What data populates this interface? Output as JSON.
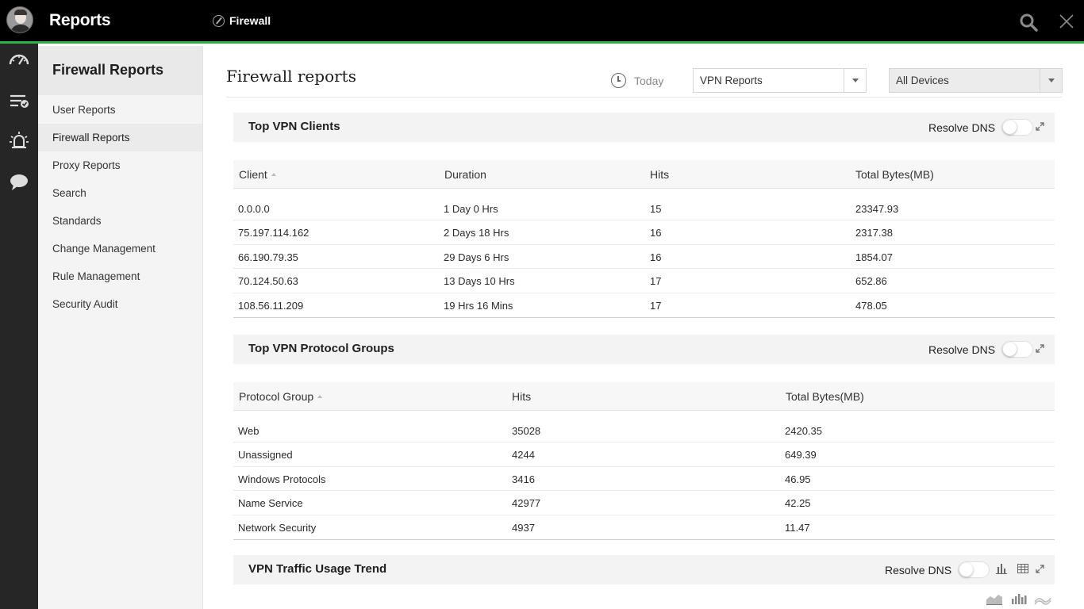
{
  "header": {
    "app_title": "Reports",
    "module": "Firewall"
  },
  "rail": {
    "items": [
      "dashboard-icon",
      "reports-icon",
      "alarms-icon",
      "chat-icon"
    ]
  },
  "sidebar": {
    "title": "Firewall Reports",
    "items": [
      {
        "label": "User Reports"
      },
      {
        "label": "Firewall Reports",
        "active": true
      },
      {
        "label": "Proxy Reports"
      },
      {
        "label": "Search"
      },
      {
        "label": "Standards"
      },
      {
        "label": "Change Management"
      },
      {
        "label": "Rule Management"
      },
      {
        "label": "Security Audit"
      }
    ]
  },
  "main": {
    "title": "Firewall reports",
    "period": "Today",
    "report_select": "VPN Reports",
    "device_select": "All Devices"
  },
  "resolve_dns_label": "Resolve DNS",
  "top_vpn_clients": {
    "title": "Top VPN Clients",
    "columns": [
      "Client",
      "Duration",
      "Hits",
      "Total Bytes(MB)"
    ],
    "rows": [
      [
        "0.0.0.0",
        "1 Day 0 Hrs",
        "15",
        "23347.93"
      ],
      [
        "75.197.114.162",
        "2 Days 18 Hrs",
        "16",
        "2317.38"
      ],
      [
        "66.190.79.35",
        "29 Days 6 Hrs",
        "16",
        "1854.07"
      ],
      [
        "70.124.50.63",
        "13 Days 10 Hrs",
        "17",
        "652.86"
      ],
      [
        "108.56.11.209",
        "19 Hrs 16 Mins",
        "17",
        "478.05"
      ]
    ]
  },
  "top_vpn_protocol_groups": {
    "title": "Top VPN Protocol Groups",
    "columns": [
      "Protocol Group",
      "Hits",
      "Total Bytes(MB)"
    ],
    "rows": [
      [
        "Web",
        "35028",
        "2420.35"
      ],
      [
        "Unassigned",
        "4244",
        "649.39"
      ],
      [
        "Windows Protocols",
        "3416",
        "46.95"
      ],
      [
        "Name Service",
        "42977",
        "42.25"
      ],
      [
        "Network Security",
        "4937",
        "11.47"
      ]
    ]
  },
  "vpn_traffic_trend": {
    "title": "VPN Traffic Usage Trend"
  }
}
